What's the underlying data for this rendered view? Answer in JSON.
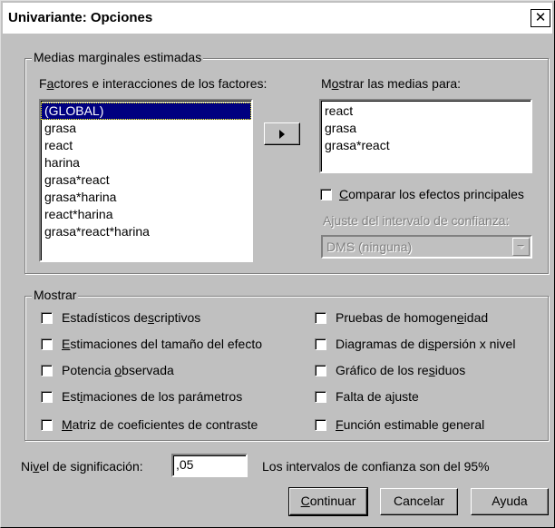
{
  "window": {
    "title": "Univariante: Opciones",
    "close_glyph": "✕"
  },
  "emm": {
    "group_label": "Medias marginales estimadas",
    "factors_label": "Factores e interacciones de los factores:",
    "factors": [
      "(GLOBAL)",
      "grasa",
      "react",
      "harina",
      "grasa*react",
      "grasa*harina",
      "react*harina",
      "grasa*react*harina"
    ],
    "selected_factor": "(GLOBAL)",
    "move_button_icon": "right-arrow-icon",
    "display_means_label": "Mostrar las medias para:",
    "display_means": [
      "react",
      "grasa",
      "grasa*react"
    ],
    "compare_main_effects": {
      "label": "Comparar los efectos principales",
      "checked": false
    },
    "ci_adjust_label": "Ajuste del intervalo de confianza:",
    "ci_adjust_value": "DMS (ninguna)"
  },
  "display": {
    "group_label": "Mostrar",
    "left": [
      {
        "label": "Estadísticos descriptivos",
        "checked": false
      },
      {
        "label": "Estimaciones del tamaño del efecto",
        "checked": false
      },
      {
        "label": "Potencia observada",
        "checked": false
      },
      {
        "label": "Estimaciones de los parámetros",
        "checked": false
      },
      {
        "label": "Matriz de coeficientes de contraste",
        "checked": false
      }
    ],
    "right": [
      {
        "label": "Pruebas de homogeneidad",
        "checked": false
      },
      {
        "label": "Diagramas de dispersión x nivel",
        "checked": false
      },
      {
        "label": "Gráfico de los residuos",
        "checked": false
      },
      {
        "label": "Falta de ajuste",
        "checked": false
      },
      {
        "label": "Función estimable general",
        "checked": false
      }
    ]
  },
  "significance": {
    "label": "Nivel de significación:",
    "value": ",05",
    "ci_text": "Los intervalos de confianza son del 95%"
  },
  "buttons": {
    "continue": "Continuar",
    "cancel": "Cancelar",
    "help": "Ayuda"
  },
  "colors": {
    "face": "#c0c0c0",
    "selection": "#000080"
  }
}
